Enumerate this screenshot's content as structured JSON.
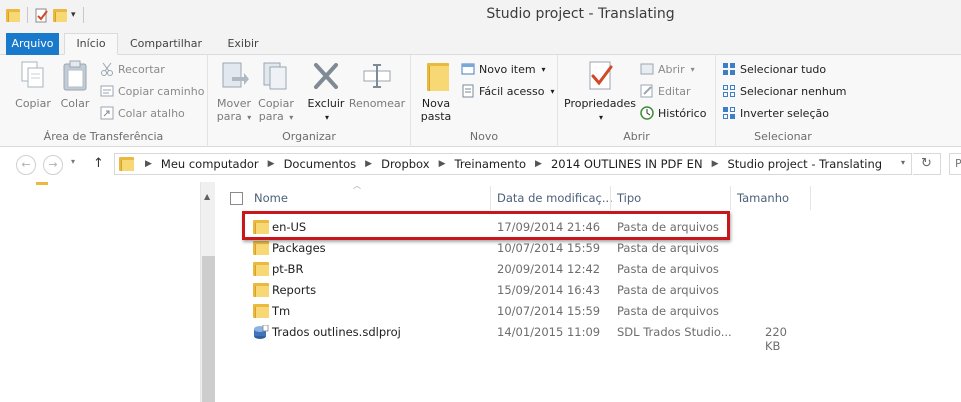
{
  "window": {
    "title": "Studio project - Translating"
  },
  "tabs": [
    "Arquivo",
    "Início",
    "Compartilhar",
    "Exibir"
  ],
  "ribbon": {
    "clipboard": {
      "label": "Área de Transferência",
      "copy": "Copiar",
      "paste": "Colar",
      "cut": "Recortar",
      "copy_path": "Copiar caminho",
      "paste_shortcut": "Colar atalho"
    },
    "organize": {
      "label": "Organizar",
      "move_to": [
        "Mover",
        "para"
      ],
      "copy_to": [
        "Copiar",
        "para"
      ],
      "delete": "Excluir",
      "rename": "Renomear"
    },
    "new": {
      "label": "Novo",
      "new_folder": [
        "Nova",
        "pasta"
      ],
      "new_item": "Novo item",
      "easy_access": "Fácil acesso"
    },
    "open": {
      "label": "Abrir",
      "properties": "Propriedades",
      "open": "Abrir",
      "edit": "Editar",
      "history": "Histórico"
    },
    "select": {
      "label": "Selecionar",
      "select_all": "Selecionar tudo",
      "select_none": "Selecionar nenhum",
      "invert": "Inverter seleção"
    }
  },
  "breadcrumbs": [
    "Meu computador",
    "Documentos",
    "Dropbox",
    "Treinamento",
    "2014 OUTLINES IN PDF EN",
    "Studio project - Translating"
  ],
  "search": {
    "placeholder": "P"
  },
  "columns": {
    "name": "Nome",
    "date": "Data de modificaç...",
    "type": "Tipo",
    "size": "Tamanho"
  },
  "files": [
    {
      "name": "en-US",
      "date": "17/09/2014 21:46",
      "type": "Pasta de arquivos",
      "size": "",
      "icon": "folder-icon"
    },
    {
      "name": "Packages",
      "date": "10/07/2014 15:59",
      "type": "Pasta de arquivos",
      "size": "",
      "icon": "folder-icon"
    },
    {
      "name": "pt-BR",
      "date": "20/09/2014 12:42",
      "type": "Pasta de arquivos",
      "size": "",
      "icon": "folder-icon"
    },
    {
      "name": "Reports",
      "date": "15/09/2014 16:43",
      "type": "Pasta de arquivos",
      "size": "",
      "icon": "folder-icon"
    },
    {
      "name": "Tm",
      "date": "10/07/2014 15:59",
      "type": "Pasta de arquivos",
      "size": "",
      "icon": "folder-icon"
    },
    {
      "name": "Trados outlines.sdlproj",
      "date": "14/01/2015 11:09",
      "type": "SDL Trados Studio...",
      "size": "220 KB",
      "icon": "sdlproj-file-icon"
    }
  ],
  "colors": {
    "accent": "#1979ca",
    "highlight_border": "#c8161d",
    "folder": "#f8d775"
  }
}
